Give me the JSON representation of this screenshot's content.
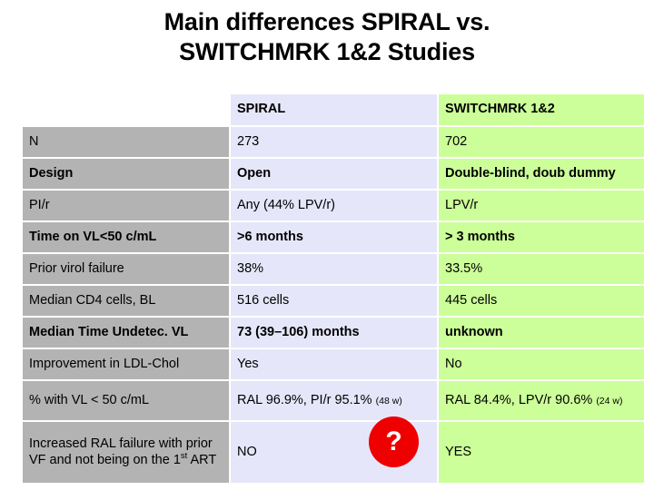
{
  "title": {
    "line1": "Main differences SPIRAL vs.",
    "line2": "SWITCHMRK 1&2 Studies"
  },
  "colors": {
    "label_column": "#b3b3b3",
    "spiral_column": "#e6e6fa",
    "switchmrk_column": "#ccff99",
    "badge": "#ee0000",
    "badge_text": "#ffffff",
    "page_background": "#ffffff"
  },
  "table": {
    "headers": {
      "label": "",
      "spiral": "SPIRAL",
      "switchmrk": "SWITCHMRK 1&2"
    },
    "rows": [
      {
        "label": "N",
        "spiral": "273",
        "switchmrk": "702",
        "bold": false
      },
      {
        "label": "Design",
        "spiral": "Open",
        "switchmrk": "Double-blind, doub dummy",
        "bold": true
      },
      {
        "label": "PI/r",
        "spiral": "Any (44% LPV/r)",
        "switchmrk": "LPV/r",
        "bold": false
      },
      {
        "label": "Time on VL<50 c/mL",
        "spiral": ">6 months",
        "switchmrk": "> 3 months",
        "bold": true
      },
      {
        "label": "Prior virol failure",
        "spiral": "38%",
        "switchmrk": "33.5%",
        "bold": false
      },
      {
        "label": "Median CD4 cells, BL",
        "spiral": "516 cells",
        "switchmrk": "445 cells",
        "bold": false
      },
      {
        "label": "Median Time Undetec. VL",
        "spiral": "73 (39–106) months",
        "switchmrk": "unknown",
        "bold": true
      },
      {
        "label": "Improvement in LDL-Chol",
        "spiral": "Yes",
        "switchmrk": "No",
        "bold": false
      }
    ],
    "row_percent_vl": {
      "label": "% with VL < 50 c/mL",
      "spiral_main": "RAL 96.9%, PI/r 95.1%",
      "spiral_note": "(48 w)",
      "switchmrk_main": "RAL 84.4%, LPV/r 90.6%",
      "switchmrk_note": "(24 w)"
    },
    "row_last": {
      "label_part1": "Increased RAL failure with prior VF and not being on the 1",
      "label_sup": "st",
      "label_part2": " ART",
      "spiral": "NO",
      "switchmrk": "YES"
    }
  },
  "badge": {
    "symbol": "?"
  }
}
